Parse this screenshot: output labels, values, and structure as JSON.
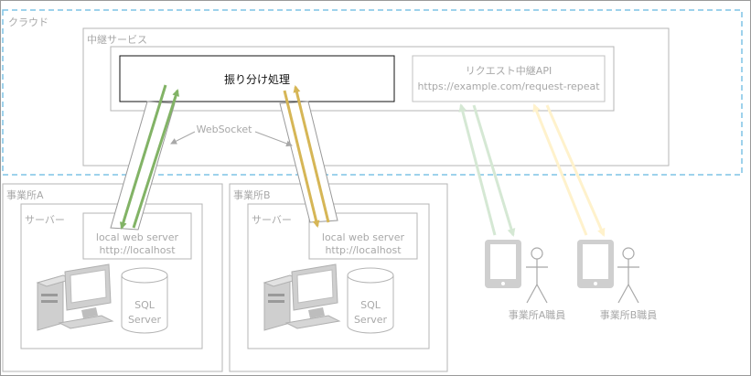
{
  "cloud": {
    "label": "クラウド"
  },
  "relay": {
    "label": "中継サービス",
    "dispatch": "振り分け処理",
    "api_title": "リクエスト中継API",
    "api_url": "https://example.com/request-repeat"
  },
  "websocket": "WebSocket",
  "office_a": {
    "label": "事業所A",
    "server_label": "サーバー",
    "web_server_line1": "local web server",
    "web_server_line2": "http://localhost",
    "db_line1": "SQL",
    "db_line2": "Server"
  },
  "office_b": {
    "label": "事業所B",
    "server_label": "サーバー",
    "web_server_line1": "local web server",
    "web_server_line2": "http://localhost",
    "db_line1": "SQL",
    "db_line2": "Server"
  },
  "staff_a": "事業所A職員",
  "staff_b": "事業所B職員",
  "colors": {
    "green": "#82b366",
    "green_light": "#d5e8d4",
    "gold": "#d6b656",
    "gold_light": "#fff2cc",
    "cloud_border": "#7ec3e6",
    "gray": "#a8a8a8"
  }
}
